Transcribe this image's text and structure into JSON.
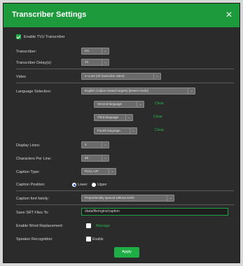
{
  "dialog": {
    "title": "Transcriber Settings",
    "close_icon": "close-icon"
  },
  "enable_tvu": {
    "label": "Enable TVU Transcriber",
    "checked": true
  },
  "transcriber": {
    "label": "Transcriber:",
    "value": "On"
  },
  "transcriber_delay": {
    "label": "Transcriber Delay(s):",
    "value": "10"
  },
  "video": {
    "label": "Video",
    "value": "In cues (All transcribe sides)"
  },
  "language": {
    "label": "Language Selection:",
    "primary": "English (Adjust related targets) [Detect mode]",
    "second": {
      "value": "Second language",
      "action": "Clear"
    },
    "third": {
      "value": "Third language",
      "action": "Clear"
    },
    "fourth": {
      "value": "Fourth language",
      "action": "Clear"
    }
  },
  "display_lines": {
    "label": "Display Lines:",
    "value": "3"
  },
  "chars_per_line": {
    "label": "Characters Per Line:",
    "value": "28"
  },
  "caption_type": {
    "label": "Caption Type:",
    "value": "ROLL-UP"
  },
  "caption_position": {
    "label": "Caption Position:",
    "options": [
      "Lower",
      "Upper"
    ],
    "selected": "Lower"
  },
  "caption_font": {
    "label": "Caption font family:",
    "value": "Proportionally spaced without serifs"
  },
  "save_srt": {
    "label": "Save SRT Files To:",
    "value": "/data/file/nginx/caption"
  },
  "word_replacement": {
    "label": "Enable Word Replacement:",
    "checked": false,
    "action": "Manage"
  },
  "speaker_recognition": {
    "label": "Speaker Recognition:",
    "checked": false,
    "text": "Enable"
  },
  "apply_label": "Apply",
  "colors": {
    "accent": "#1fae45",
    "title_bar": "#1d9b3c",
    "dialog_bg": "#2b2b2b"
  }
}
